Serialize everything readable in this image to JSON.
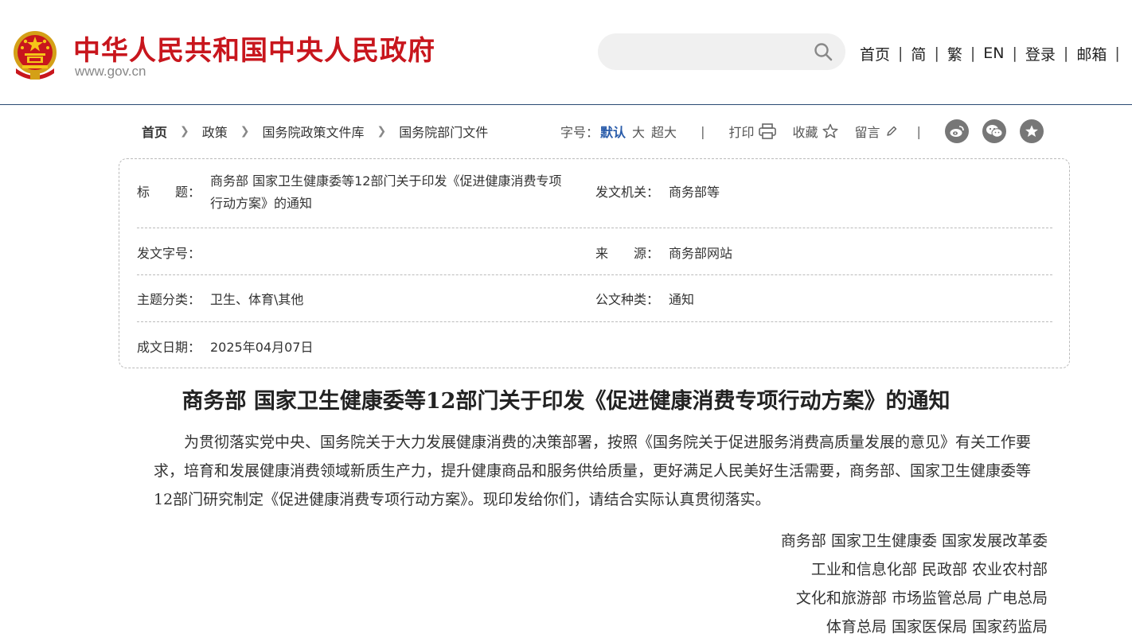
{
  "header": {
    "site_title": "中华人民共和国中央人民政府",
    "site_domain": "www.gov.cn",
    "search": {
      "placeholder": "",
      "value": ""
    },
    "nav": [
      "首页",
      "简",
      "繁",
      "EN",
      "登录",
      "邮箱"
    ]
  },
  "breadcrumb": [
    "首页",
    "政策",
    "国务院政策文件库",
    "国务院部门文件"
  ],
  "toolbar": {
    "font_label": "字号：",
    "font_options": [
      "默认",
      "大",
      "超大"
    ],
    "print": "打印",
    "favorite": "收藏",
    "comment": "留言"
  },
  "info": {
    "title_label": "标　　题：",
    "title_line1": "商务部 国家卫生健康委等12部门关于印发《促进健康消费专项",
    "title_line2": "行动方案》的通知",
    "issuer_label": "发文机关：",
    "issuer": "商务部等",
    "doc_no_label": "发文字号：",
    "doc_no": "",
    "source_label": "来　　源：",
    "source": "商务部网站",
    "topic_label": "主题分类：",
    "topic": "卫生、体育\\其他",
    "doc_type_label": "公文种类：",
    "doc_type": "通知",
    "date_label": "成文日期：",
    "date": "2025年04月07日"
  },
  "article": {
    "title": "商务部 国家卫生健康委等12部门关于印发《促进健康消费专项行动方案》的通知",
    "paragraph": "为贯彻落实党中央、国务院关于大力发展健康消费的决策部署，按照《国务院关于促进服务消费高质量发展的意见》有关工作要求，培育和发展健康消费领域新质生产力，提升健康商品和服务供给质量，更好满足人民美好生活需要，商务部、国家卫生健康委等12部门研究制定《促进健康消费专项行动方案》。现印发给你们，请结合实际认真贯彻落实。",
    "signers": [
      "商务部 国家卫生健康委 国家发展改革委",
      "工业和信息化部 民政部 农业农村部",
      "文化和旅游部 市场监管总局 广电总局",
      "体育总局 国家医保局 国家药监局"
    ]
  },
  "colors": {
    "brand_red": "#c8161d",
    "accent_blue": "#2a5caa",
    "header_rule": "#2a4a73"
  }
}
